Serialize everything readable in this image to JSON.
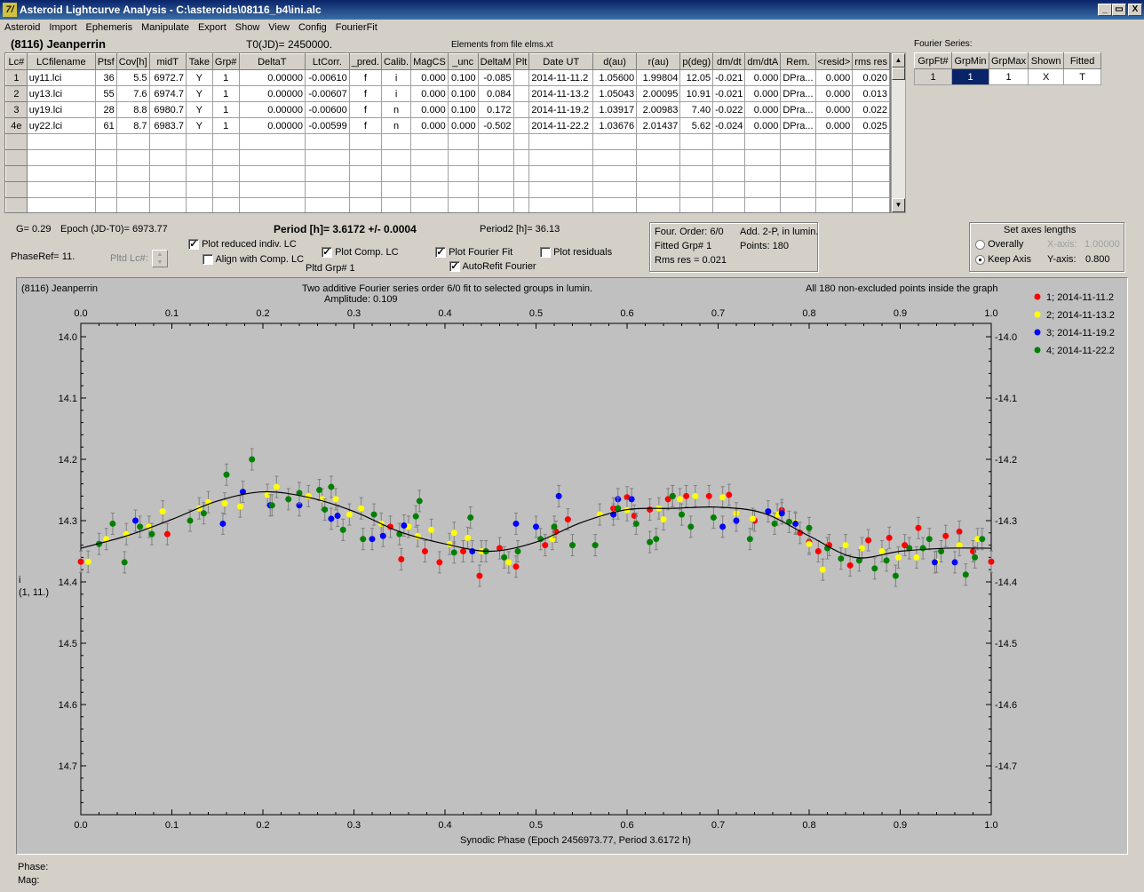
{
  "window": {
    "title": "Asteroid Lightcurve Analysis - C:\\asteroids\\08116_b4\\ini.alc",
    "logo": "7/"
  },
  "menu": [
    "Asteroid",
    "Import",
    "Ephemeris",
    "Manipulate",
    "Export",
    "Show",
    "View",
    "Config",
    "FourierFit"
  ],
  "header": {
    "asteroid": "(8116) Jeanperrin",
    "t0": "T0(JD)= 2450000.",
    "elements": "Elements from file elms.xt",
    "fourier_label": "Fourier Series:"
  },
  "lc_table": {
    "columns": [
      "Lc#",
      "LCfilename",
      "Ptsf",
      "Cov[h]",
      "midT",
      "Take",
      "Grp#",
      "DeltaT",
      "LtCorr.",
      "_pred.",
      "Calib.",
      "MagCS",
      "_unc",
      "DeltaM",
      "Plt",
      "Date UT",
      "d(au)",
      "r(au)",
      "p(deg)",
      "dm/dt",
      "dm/dtA",
      "Rem.",
      "<resid>",
      "rms res"
    ],
    "rows": [
      [
        "1",
        "uy11.lci",
        "36",
        "5.5",
        "6972.7",
        "Y",
        "1",
        "0.00000",
        "-0.00610",
        "f",
        "i",
        "0.000",
        "0.100",
        "-0.085",
        "",
        "2014-11-11.2",
        "1.05600",
        "1.99804",
        "12.05",
        "-0.021",
        "0.000",
        "DPra...",
        "0.000",
        "0.020"
      ],
      [
        "2",
        "uy13.lci",
        "55",
        "7.6",
        "6974.7",
        "Y",
        "1",
        "0.00000",
        "-0.00607",
        "f",
        "i",
        "0.000",
        "0.100",
        "0.084",
        "",
        "2014-11-13.2",
        "1.05043",
        "2.00095",
        "10.91",
        "-0.021",
        "0.000",
        "DPra...",
        "0.000",
        "0.013"
      ],
      [
        "3",
        "uy19.lci",
        "28",
        "8.8",
        "6980.7",
        "Y",
        "1",
        "0.00000",
        "-0.00600",
        "f",
        "n",
        "0.000",
        "0.100",
        "0.172",
        "",
        "2014-11-19.2",
        "1.03917",
        "2.00983",
        "7.40",
        "-0.022",
        "0.000",
        "DPra...",
        "0.000",
        "0.022"
      ],
      [
        "4e",
        "uy22.lci",
        "61",
        "8.7",
        "6983.7",
        "Y",
        "1",
        "0.00000",
        "-0.00599",
        "f",
        "n",
        "0.000",
        "0.000",
        "-0.502",
        "",
        "2014-11-22.2",
        "1.03676",
        "2.01437",
        "5.62",
        "-0.024",
        "0.000",
        "DPra...",
        "0.000",
        "0.025"
      ]
    ],
    "empty_rows": 5
  },
  "fourier_table": {
    "columns": [
      "GrpFt#",
      "GrpMin",
      "GrpMax",
      "Shown",
      "Fitted"
    ],
    "row": [
      "1",
      "1",
      "1",
      "X",
      "T"
    ]
  },
  "info": {
    "g": "G= 0.29",
    "epoch": "Epoch (JD-T0)= 6973.77",
    "period": "Period [h]= 3.6172 +/- 0.0004",
    "period2": "Period2 [h]= 36.13",
    "phaseref": "PhaseRef= 11.",
    "pltd_lc": "Pltd Lc#:",
    "pltd_grp": "Pltd Grp#  1",
    "four_order": "Four. Order:  6/0",
    "add2p": "Add. 2-P, in lumin.",
    "fitted_grp": "Fitted Grp# 1",
    "points": "Points: 180",
    "rms": "Rms res     = 0.021"
  },
  "checkboxes": [
    {
      "label": "Plot reduced indiv. LC",
      "checked": true
    },
    {
      "label": "Align with Comp. LC",
      "checked": false
    },
    {
      "label": "Plot Comp. LC",
      "checked": true
    },
    {
      "label": "Plot Fourier Fit",
      "checked": true
    },
    {
      "label": "AutoRefit Fourier",
      "checked": true
    },
    {
      "label": "Plot residuals",
      "checked": false
    }
  ],
  "axes_box": {
    "title": "Set axes lengths",
    "overally": "Overally",
    "keep": "Keep Axis",
    "xaxis_label": "X-axis:",
    "xaxis_val": "1.00000",
    "yaxis_label": "Y-axis:",
    "yaxis_val": "0.800"
  },
  "plot": {
    "name": "(8116) Jeanperrin",
    "title": "Two additive Fourier series order 6/0 fit to selected groups in lumin.",
    "amplitude": "Amplitude: 0.109",
    "points_note": "All 180 non-excluded points inside the graph",
    "ylabel1": "i",
    "ylabel2": "(1, 11.)",
    "xlabel": "Synodic Phase (Epoch 2456973.77, Period 3.6172 h)"
  },
  "status": {
    "phase": "Phase:",
    "mag": "Mag:"
  },
  "chart_data": {
    "type": "scatter",
    "xlabel": "Synodic Phase (Epoch 2456973.77, Period 3.6172 h)",
    "ylabel": "i",
    "xlim": [
      0,
      1
    ],
    "ylim": [
      14.0,
      14.8
    ],
    "y_inverted": true,
    "xticks": [
      "0.0",
      "0.1",
      "0.2",
      "0.3",
      "0.4",
      "0.5",
      "0.6",
      "0.7",
      "0.8",
      "0.9",
      "1.0"
    ],
    "yticks": [
      "14.0",
      "14.1",
      "14.2",
      "14.3",
      "14.4",
      "14.5",
      "14.6",
      "14.7"
    ],
    "legend_position": "right",
    "series": [
      {
        "name": "1; 2014-11-11.2",
        "color": "#ff0000",
        "points": [
          [
            0.0,
            14.367
          ],
          [
            0.095,
            14.322
          ],
          [
            0.34,
            14.31
          ],
          [
            0.352,
            14.363
          ],
          [
            0.378,
            14.35
          ],
          [
            0.394,
            14.368
          ],
          [
            0.42,
            14.35
          ],
          [
            0.438,
            14.39
          ],
          [
            0.46,
            14.345
          ],
          [
            0.478,
            14.375
          ],
          [
            0.51,
            14.34
          ],
          [
            0.522,
            14.318
          ],
          [
            0.535,
            14.298
          ],
          [
            0.585,
            14.28
          ],
          [
            0.6,
            14.262
          ],
          [
            0.608,
            14.292
          ],
          [
            0.625,
            14.282
          ],
          [
            0.645,
            14.265
          ],
          [
            0.665,
            14.26
          ],
          [
            0.69,
            14.26
          ],
          [
            0.712,
            14.258
          ],
          [
            0.74,
            14.3
          ],
          [
            0.77,
            14.283
          ],
          [
            0.79,
            14.32
          ],
          [
            0.8,
            14.335
          ],
          [
            0.81,
            14.35
          ],
          [
            0.822,
            14.34
          ],
          [
            0.845,
            14.373
          ],
          [
            0.865,
            14.332
          ],
          [
            0.888,
            14.328
          ],
          [
            0.905,
            14.34
          ],
          [
            0.92,
            14.312
          ],
          [
            0.95,
            14.325
          ],
          [
            0.965,
            14.318
          ],
          [
            0.98,
            14.35
          ],
          [
            1.0,
            14.367
          ]
        ]
      },
      {
        "name": "2; 2014-11-13.2",
        "color": "#ffff00",
        "points": [
          [
            0.008,
            14.367
          ],
          [
            0.028,
            14.33
          ],
          [
            0.05,
            14.322
          ],
          [
            0.075,
            14.31
          ],
          [
            0.09,
            14.285
          ],
          [
            0.13,
            14.28
          ],
          [
            0.14,
            14.27
          ],
          [
            0.158,
            14.272
          ],
          [
            0.175,
            14.277
          ],
          [
            0.205,
            14.258
          ],
          [
            0.215,
            14.245
          ],
          [
            0.25,
            14.26
          ],
          [
            0.265,
            14.265
          ],
          [
            0.28,
            14.265
          ],
          [
            0.295,
            14.29
          ],
          [
            0.308,
            14.28
          ],
          [
            0.33,
            14.305
          ],
          [
            0.36,
            14.31
          ],
          [
            0.37,
            14.325
          ],
          [
            0.385,
            14.315
          ],
          [
            0.405,
            14.338
          ],
          [
            0.41,
            14.32
          ],
          [
            0.425,
            14.328
          ],
          [
            0.44,
            14.35
          ],
          [
            0.47,
            14.368
          ],
          [
            0.518,
            14.33
          ],
          [
            0.57,
            14.29
          ],
          [
            0.6,
            14.283
          ],
          [
            0.635,
            14.28
          ],
          [
            0.64,
            14.298
          ],
          [
            0.658,
            14.265
          ],
          [
            0.675,
            14.26
          ],
          [
            0.705,
            14.262
          ],
          [
            0.72,
            14.288
          ],
          [
            0.738,
            14.297
          ],
          [
            0.765,
            14.29
          ],
          [
            0.785,
            14.303
          ],
          [
            0.8,
            14.338
          ],
          [
            0.815,
            14.38
          ],
          [
            0.84,
            14.34
          ],
          [
            0.858,
            14.345
          ],
          [
            0.88,
            14.35
          ],
          [
            0.898,
            14.36
          ],
          [
            0.918,
            14.36
          ],
          [
            0.94,
            14.367
          ],
          [
            0.965,
            14.34
          ],
          [
            0.985,
            14.33
          ]
        ]
      },
      {
        "name": "3; 2014-11-19.2",
        "color": "#0000ff",
        "points": [
          [
            0.06,
            14.3
          ],
          [
            0.156,
            14.305
          ],
          [
            0.178,
            14.253
          ],
          [
            0.208,
            14.275
          ],
          [
            0.24,
            14.275
          ],
          [
            0.275,
            14.297
          ],
          [
            0.282,
            14.292
          ],
          [
            0.32,
            14.33
          ],
          [
            0.332,
            14.325
          ],
          [
            0.355,
            14.308
          ],
          [
            0.43,
            14.35
          ],
          [
            0.478,
            14.305
          ],
          [
            0.5,
            14.31
          ],
          [
            0.525,
            14.26
          ],
          [
            0.585,
            14.29
          ],
          [
            0.59,
            14.265
          ],
          [
            0.605,
            14.265
          ],
          [
            0.65,
            14.26
          ],
          [
            0.705,
            14.31
          ],
          [
            0.72,
            14.3
          ],
          [
            0.755,
            14.285
          ],
          [
            0.77,
            14.288
          ],
          [
            0.785,
            14.305
          ],
          [
            0.938,
            14.368
          ],
          [
            0.96,
            14.368
          ]
        ]
      },
      {
        "name": "4; 2014-11-22.2",
        "color": "#008000",
        "points": [
          [
            0.02,
            14.338
          ],
          [
            0.035,
            14.305
          ],
          [
            0.048,
            14.368
          ],
          [
            0.065,
            14.31
          ],
          [
            0.078,
            14.322
          ],
          [
            0.12,
            14.3
          ],
          [
            0.135,
            14.288
          ],
          [
            0.16,
            14.225
          ],
          [
            0.188,
            14.2
          ],
          [
            0.21,
            14.275
          ],
          [
            0.228,
            14.265
          ],
          [
            0.24,
            14.255
          ],
          [
            0.262,
            14.25
          ],
          [
            0.268,
            14.282
          ],
          [
            0.275,
            14.245
          ],
          [
            0.288,
            14.315
          ],
          [
            0.31,
            14.33
          ],
          [
            0.322,
            14.29
          ],
          [
            0.35,
            14.322
          ],
          [
            0.368,
            14.293
          ],
          [
            0.372,
            14.268
          ],
          [
            0.41,
            14.352
          ],
          [
            0.428,
            14.295
          ],
          [
            0.445,
            14.35
          ],
          [
            0.465,
            14.36
          ],
          [
            0.48,
            14.35
          ],
          [
            0.505,
            14.33
          ],
          [
            0.52,
            14.31
          ],
          [
            0.54,
            14.34
          ],
          [
            0.565,
            14.34
          ],
          [
            0.59,
            14.28
          ],
          [
            0.61,
            14.305
          ],
          [
            0.625,
            14.335
          ],
          [
            0.632,
            14.33
          ],
          [
            0.65,
            14.26
          ],
          [
            0.66,
            14.29
          ],
          [
            0.67,
            14.31
          ],
          [
            0.695,
            14.295
          ],
          [
            0.735,
            14.33
          ],
          [
            0.762,
            14.305
          ],
          [
            0.778,
            14.302
          ],
          [
            0.8,
            14.312
          ],
          [
            0.82,
            14.345
          ],
          [
            0.835,
            14.362
          ],
          [
            0.855,
            14.365
          ],
          [
            0.872,
            14.378
          ],
          [
            0.885,
            14.365
          ],
          [
            0.895,
            14.39
          ],
          [
            0.91,
            14.345
          ],
          [
            0.925,
            14.345
          ],
          [
            0.932,
            14.33
          ],
          [
            0.945,
            14.35
          ],
          [
            0.972,
            14.388
          ],
          [
            0.982,
            14.36
          ],
          [
            0.99,
            14.33
          ]
        ]
      }
    ],
    "fit": [
      [
        0.0,
        14.345
      ],
      [
        0.05,
        14.325
      ],
      [
        0.1,
        14.298
      ],
      [
        0.15,
        14.268
      ],
      [
        0.2,
        14.253
      ],
      [
        0.25,
        14.262
      ],
      [
        0.3,
        14.285
      ],
      [
        0.35,
        14.318
      ],
      [
        0.4,
        14.338
      ],
      [
        0.45,
        14.35
      ],
      [
        0.5,
        14.335
      ],
      [
        0.55,
        14.303
      ],
      [
        0.6,
        14.282
      ],
      [
        0.65,
        14.28
      ],
      [
        0.7,
        14.278
      ],
      [
        0.75,
        14.288
      ],
      [
        0.8,
        14.325
      ],
      [
        0.85,
        14.36
      ],
      [
        0.9,
        14.35
      ],
      [
        0.95,
        14.345
      ],
      [
        1.0,
        14.345
      ]
    ]
  }
}
